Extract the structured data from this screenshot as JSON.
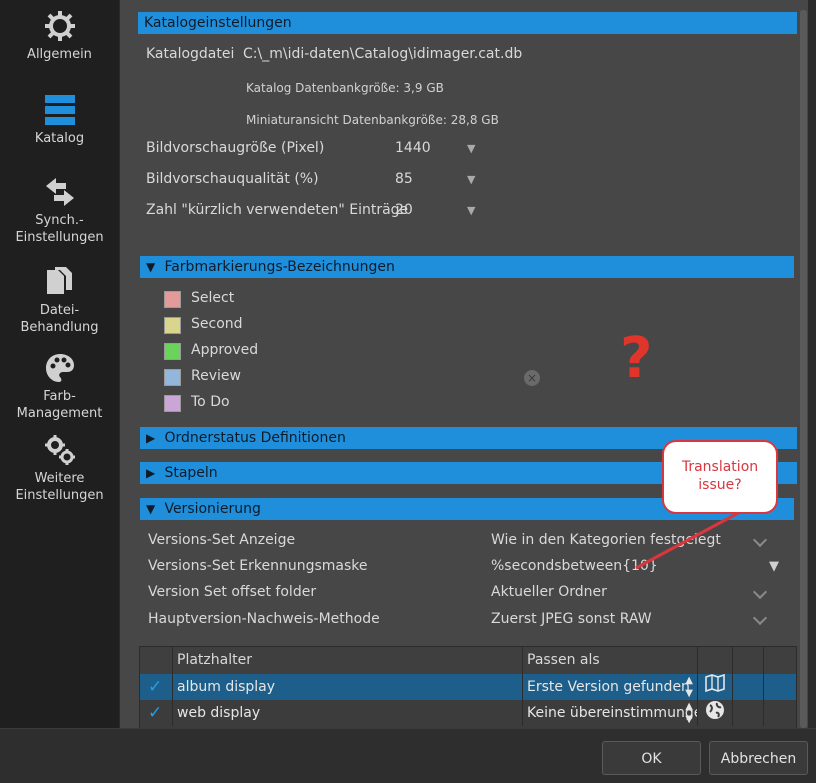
{
  "sidebar": {
    "items": [
      {
        "label": "Allgemein",
        "icon": "gear-icon"
      },
      {
        "label": "Katalog",
        "icon": "catalog-icon"
      },
      {
        "label": "Synch.-\nEinstellungen",
        "icon": "sync-icon"
      },
      {
        "label": "Datei-\nBehandlung",
        "icon": "file-icon"
      },
      {
        "label": "Farb-\nManagement",
        "icon": "palette-icon"
      },
      {
        "label": "Weitere\nEinstellungen",
        "icon": "gears-icon"
      }
    ]
  },
  "catalog": {
    "header": "Katalogeinstellungen",
    "file_label": "Katalogdatei",
    "file_value": "C:\\_m\\idi-daten\\Catalog\\idimager.cat.db",
    "db_size": "Katalog Datenbankgröße: 3,9 GB",
    "thumb_size": "Miniaturansicht Datenbankgröße: 28,8 GB",
    "settings": [
      {
        "label": "Bildvorschaugröße (Pixel)",
        "value": "1440"
      },
      {
        "label": "Bildvorschauqualität (%)",
        "value": "85"
      },
      {
        "label": "Zahl \"kürzlich verwendeten\" Einträge",
        "value": "20"
      }
    ]
  },
  "color_labels": {
    "header": "Farbmarkierungs-Bezeichnungen",
    "items": [
      {
        "label": "Select",
        "color": "#e39a9a"
      },
      {
        "label": "Second",
        "color": "#d9d58c"
      },
      {
        "label": "Approved",
        "color": "#6ad35c"
      },
      {
        "label": "Review",
        "color": "#92b6dc"
      },
      {
        "label": "To Do",
        "color": "#c9a6d6"
      }
    ]
  },
  "folder_status": {
    "header": "Ordnerstatus Definitionen"
  },
  "stacks": {
    "header": "Stapeln"
  },
  "versioning": {
    "header": "Versionierung",
    "rows": [
      {
        "label": "Versions-Set Anzeige",
        "value": "Wie in den Kategorien festgelegt"
      },
      {
        "label": "Versions-Set Erkennungsmaske",
        "value": "%secondsbetween{10}"
      },
      {
        "label": "Version Set offset folder",
        "value": "Aktueller Ordner"
      },
      {
        "label": "Hauptversion-Nachweis-Methode",
        "value": "Zuerst JPEG sonst RAW"
      }
    ]
  },
  "table": {
    "headers": [
      "Platzhalter",
      "Passen als"
    ],
    "rows": [
      {
        "checked": "✓",
        "name": "album display",
        "match": "Erste Version gefunden",
        "icon": "album-icon"
      },
      {
        "checked": "✓",
        "name": "web display",
        "match": "Keine übereinstimmunge",
        "icon": "globe-icon"
      }
    ]
  },
  "annotation": {
    "question": "?",
    "bubble_text": "Translation issue?"
  },
  "buttons": {
    "ok": "OK",
    "cancel": "Abbrechen"
  },
  "colors": {
    "accent": "#1f8fdc",
    "annotation": "#d9363e"
  }
}
